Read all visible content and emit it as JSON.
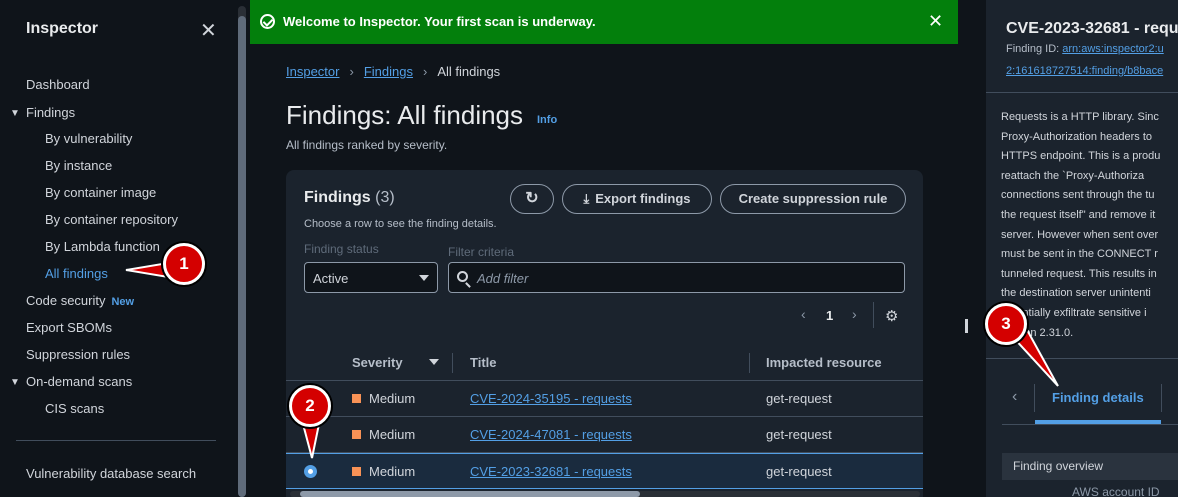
{
  "sidebar": {
    "title": "Inspector",
    "items": [
      {
        "label": "Dashboard"
      },
      {
        "label": "Findings"
      },
      {
        "label": "By vulnerability"
      },
      {
        "label": "By instance"
      },
      {
        "label": "By container image"
      },
      {
        "label": "By container repository"
      },
      {
        "label": "By Lambda function"
      },
      {
        "label": "All findings"
      },
      {
        "label": "Code security",
        "badge": "New"
      },
      {
        "label": "Export SBOMs"
      },
      {
        "label": "Suppression rules"
      },
      {
        "label": "On-demand scans"
      },
      {
        "label": "CIS scans"
      },
      {
        "label": "Vulnerability database search"
      }
    ]
  },
  "flash": {
    "message": "Welcome to Inspector. Your first scan is underway."
  },
  "breadcrumbs": [
    "Inspector",
    "Findings",
    "All findings"
  ],
  "page": {
    "title": "Findings: All findings",
    "info": "Info",
    "subtitle": "All findings ranked by severity."
  },
  "panel": {
    "title": "Findings",
    "count": "(3)",
    "description": "Choose a row to see the finding details.",
    "export_label": "Export findings",
    "suppression_label": "Create suppression rule",
    "status_label": "Finding status",
    "status_value": "Active",
    "filter_label": "Filter criteria",
    "filter_placeholder": "Add filter",
    "page_number": "1"
  },
  "table": {
    "columns": [
      "Severity",
      "Title",
      "Impacted resource"
    ],
    "rows": [
      {
        "severity": "Medium",
        "title": "CVE-2024-35195 - requests",
        "resource": "get-request",
        "selected": false
      },
      {
        "severity": "Medium",
        "title": "CVE-2024-47081 - requests",
        "resource": "get-request",
        "selected": false
      },
      {
        "severity": "Medium",
        "title": "CVE-2023-32681 - requests",
        "resource": "get-request",
        "selected": true
      }
    ]
  },
  "detail": {
    "title": "CVE-2023-32681 - requ",
    "finding_id_label": "Finding ID: ",
    "arn_part1": "arn:aws:inspector2:u",
    "arn_part2": "2:161618727514:finding/b8bace",
    "description_lines": [
      "Requests is a HTTP library. Sinc",
      "Proxy-Authorization headers to",
      "HTTPS endpoint. This is a produ",
      "reattach the `Proxy-Authoriza",
      "connections sent through the tu",
      "the request itself\" and remove it",
      "server. However when sent over",
      "must be sent in the CONNECT r",
      "tunneled request. This results in",
      "the destination server unintenti",
      "potentially exfiltrate sensitive i",
      "version 2.31.0."
    ],
    "tab_label": "Finding details",
    "overview_label": "Finding overview",
    "account_label": "AWS account ID"
  },
  "callouts": [
    "1",
    "2",
    "3"
  ],
  "colors": {
    "accent": "#539fe5",
    "success": "#037f0c",
    "severity_medium": "#f89256",
    "callout": "#d40000"
  }
}
